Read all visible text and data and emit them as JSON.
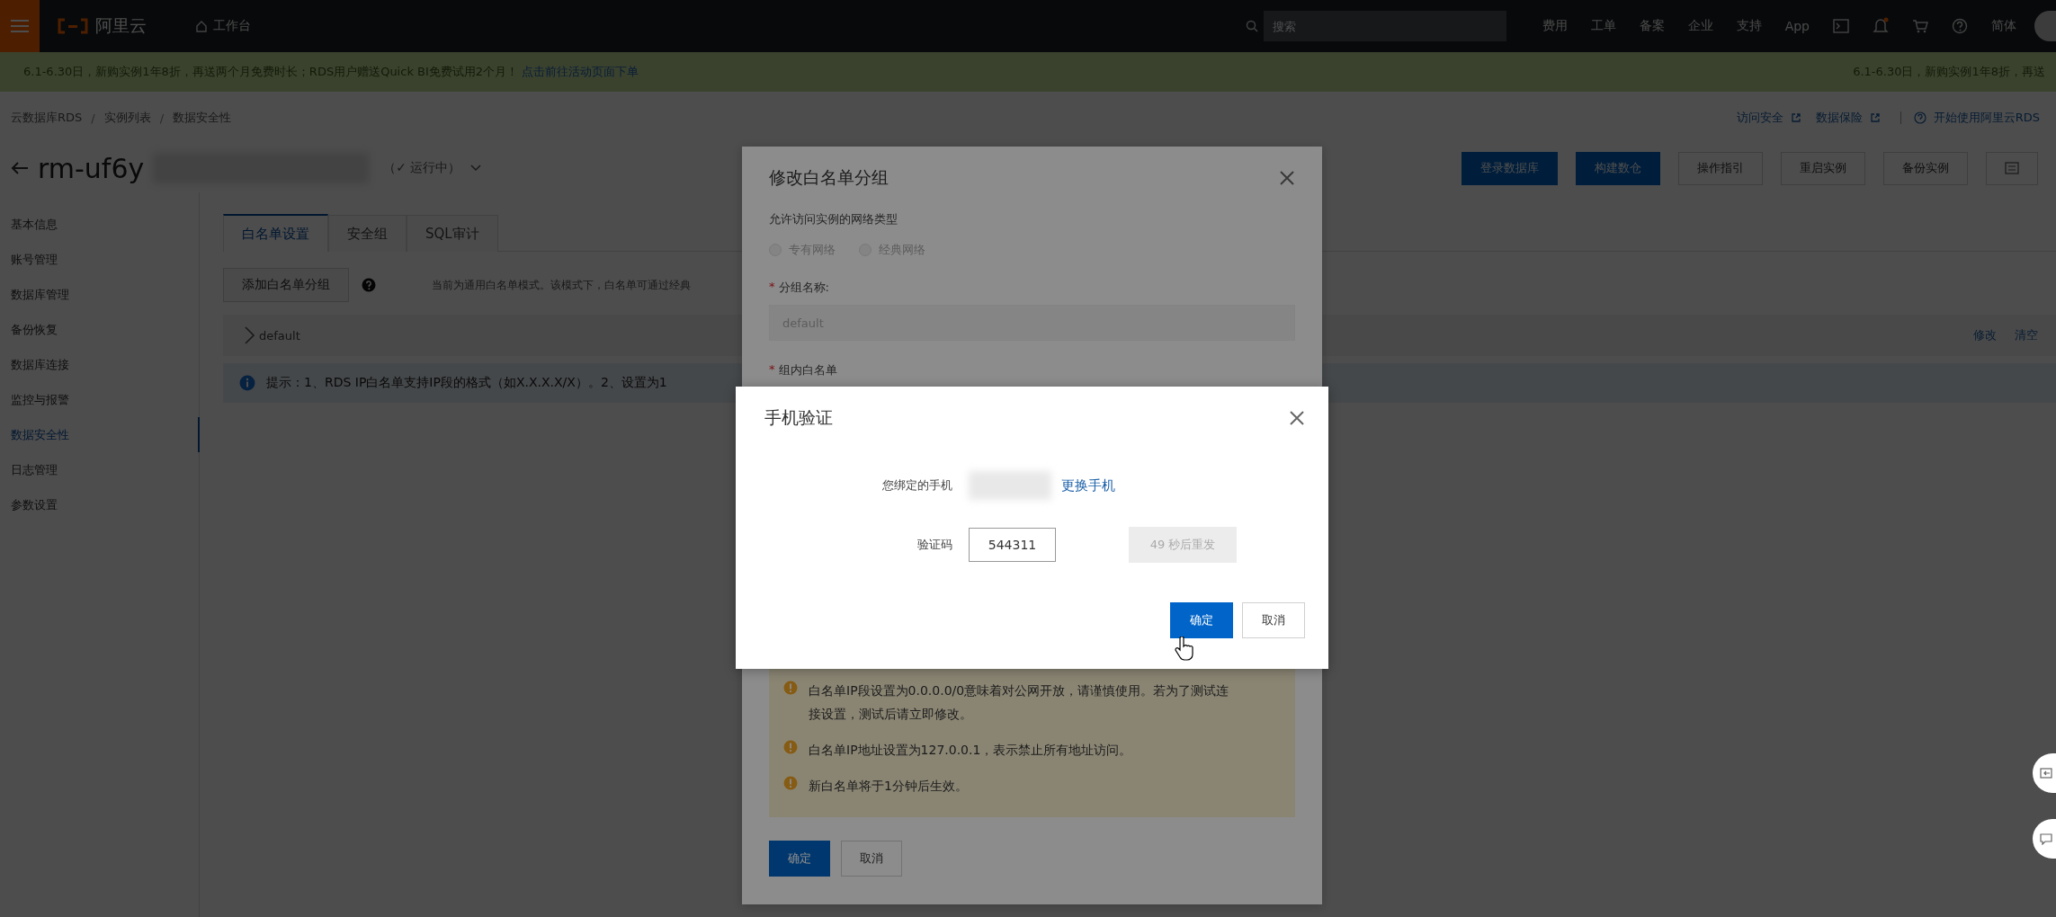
{
  "top_bar": {
    "logo": "阿里云",
    "workbench": "工作台",
    "search": {
      "placeholder": "搜索"
    },
    "menu": [
      "费用",
      "工单",
      "备案",
      "企业",
      "支持",
      "App"
    ],
    "language": "简体"
  },
  "banner": {
    "text": "6.1-6.30日，新购实例1年8折，再送两个月免费时长；RDS用户赠送Quick BI免费试用2个月！",
    "link": "点击前往活动页面下单",
    "repeat": "6.1-6.30日，新购实例1年8折，再送"
  },
  "breadcrumb": [
    "云数据库RDS",
    "实例列表",
    "数据安全性"
  ],
  "breadcrumb_separator": "/",
  "top_links": [
    "访问安全",
    "数据保险"
  ],
  "guide_link": "开始使用阿里云RDS",
  "instance": {
    "name": "rm-uf6y",
    "status": "（✓ 运行中）"
  },
  "actions": [
    {
      "kind": "primary",
      "label": "登录数据库"
    },
    {
      "kind": "primary",
      "label": "构建数仓"
    },
    {
      "kind": "default",
      "label": "操作指引"
    },
    {
      "kind": "default",
      "label": "重启实例"
    },
    {
      "kind": "default",
      "label": "备份实例"
    },
    {
      "kind": "icon"
    }
  ],
  "sidebar": [
    {
      "label": "基本信息",
      "selected": false
    },
    {
      "label": "账号管理",
      "selected": false
    },
    {
      "label": "数据库管理",
      "selected": false
    },
    {
      "label": "备份恢复",
      "selected": false
    },
    {
      "label": "数据库连接",
      "selected": false
    },
    {
      "label": "监控与报警",
      "selected": false
    },
    {
      "label": "数据安全性",
      "selected": true
    },
    {
      "label": "日志管理",
      "selected": false
    },
    {
      "label": "参数设置",
      "selected": false
    }
  ],
  "tabs": [
    {
      "label": "白名单设置",
      "selected": true
    },
    {
      "label": "安全组",
      "selected": false
    },
    {
      "label": "SQL审计",
      "selected": false
    }
  ],
  "add_group_button": "添加白名单分组",
  "mode_note": "当前为通用白名单模式。该模式下，白名单可通过经典",
  "groups": [
    {
      "name": "default",
      "expanded": false,
      "actions": [
        "修改",
        "清空"
      ]
    }
  ],
  "tip": "提示：1、RDS IP白名单支持IP段的格式（如X.X.X.X/X）。2、设置为1",
  "edit_dialog": {
    "title": "修改白名单分组",
    "network_label": "允许访问实例的网络类型",
    "network_disabled": true,
    "network_types": [
      {
        "label": "专有网络",
        "selected": false
      },
      {
        "label": "经典网络",
        "selected": false
      }
    ],
    "group_name": {
      "required_mark": "*",
      "label": "分组名称:",
      "value": "default",
      "disabled": true
    },
    "whitelist": {
      "required_mark": "*",
      "label": "组内白名单"
    },
    "warnings": [
      "白名单IP段设置为0.0.0.0/0意味着对公网开放，请谨慎使用。若为了测试连接设置，测试后请立即修改。",
      "白名单IP地址设置为127.0.0.1，表示禁止所有地址访问。",
      "新白名单将于1分钟后生效。"
    ],
    "buttons": [
      {
        "kind": "primary",
        "label": "确定"
      },
      {
        "kind": "default",
        "label": "取消"
      }
    ]
  },
  "phone_dialog": {
    "title": "手机验证",
    "phone_label": "您绑定的手机",
    "change_link": "更换手机",
    "code_label": "验证码",
    "code_value": "544311",
    "resend": {
      "label": "49 秒后重发",
      "disabled": true
    },
    "buttons": [
      {
        "kind": "primary",
        "label": "确定"
      },
      {
        "kind": "default",
        "label": "取消"
      }
    ]
  }
}
